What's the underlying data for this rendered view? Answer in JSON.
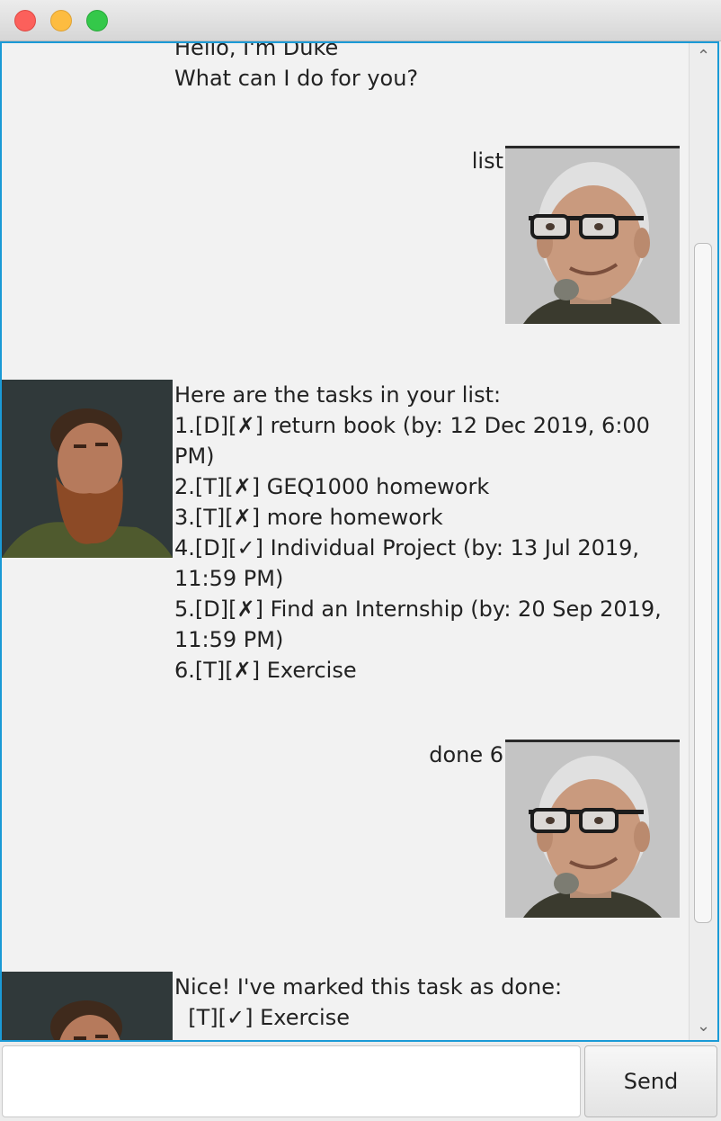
{
  "window": {
    "title": ""
  },
  "conversation": [
    {
      "speaker": "duke",
      "text": "Hello, I'm Duke\nWhat can I do for you?",
      "avatar": "bearded-man-avatar"
    },
    {
      "speaker": "user",
      "text": "list",
      "avatar": "man-with-glasses-avatar"
    },
    {
      "speaker": "duke",
      "text": "Here are the tasks in your list:\n1.[D][✗] return book (by: 12 Dec 2019, 6:00\nPM)\n2.[T][✗] GEQ1000 homework\n3.[T][✗] more homework\n4.[D][✓] Individual Project (by: 13 Jul 2019,\n11:59 PM)\n5.[D][✗] Find an Internship (by: 20 Sep 2019,\n11:59 PM)\n6.[T][✗] Exercise",
      "avatar": "bearded-man-avatar"
    },
    {
      "speaker": "user",
      "text": "done 6",
      "avatar": "man-with-glasses-avatar"
    },
    {
      "speaker": "duke",
      "text": "Nice! I've marked this task as done:\n  [T][✓] Exercise",
      "avatar": "bearded-man-avatar"
    }
  ],
  "scrollbar": {
    "up_icon": "chevron-up-icon",
    "down_icon": "chevron-down-icon",
    "up_glyph": "⌃",
    "down_glyph": "⌄"
  },
  "input": {
    "value": "",
    "placeholder": ""
  },
  "send_button": {
    "label": "Send"
  },
  "colors": {
    "focus_border": "#1a9ad6",
    "chat_background": "#f2f2f2",
    "close": "#fc605b",
    "minimize": "#fdbc40",
    "maximize": "#34c84a"
  }
}
